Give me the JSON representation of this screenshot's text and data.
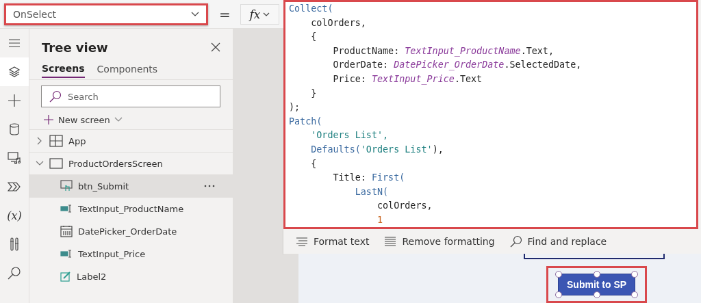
{
  "formula_bar": {
    "property": "OnSelect",
    "highlighted": true,
    "equals": "=",
    "fx": "fx"
  },
  "rail": [
    {
      "kind": "menu",
      "selected": false
    },
    {
      "kind": "layers",
      "selected": true
    },
    {
      "kind": "plus",
      "selected": false
    },
    {
      "kind": "data",
      "selected": false
    },
    {
      "kind": "media",
      "selected": false
    },
    {
      "kind": "automate",
      "selected": false
    },
    {
      "kind": "variables",
      "label": "(x)",
      "selected": false
    },
    {
      "kind": "tools",
      "selected": false
    },
    {
      "kind": "search",
      "selected": false
    }
  ],
  "tree_view": {
    "title": "Tree view",
    "tabs": [
      {
        "label": "Screens",
        "selected": true
      },
      {
        "label": "Components",
        "selected": false
      }
    ],
    "search": {
      "placeholder": "Search"
    },
    "new_screen": "New screen",
    "items": [
      {
        "label": "App",
        "kind": "app",
        "expanded": false,
        "selected": false
      },
      {
        "label": "ProductOrdersScreen",
        "kind": "screen",
        "expanded": true,
        "selected": false,
        "children": [
          {
            "label": "btn_Submit",
            "kind": "button",
            "selected": true
          },
          {
            "label": "TextInput_ProductName",
            "kind": "text-input",
            "selected": false
          },
          {
            "label": "DatePicker_OrderDate",
            "kind": "date-picker",
            "selected": false
          },
          {
            "label": "TextInput_Price",
            "kind": "text-input",
            "selected": false
          },
          {
            "label": "Label2",
            "kind": "label",
            "selected": false
          }
        ]
      }
    ]
  },
  "formula_editor": {
    "highlighted": true,
    "lines": [
      [
        {
          "text": "Collect(",
          "kind": "fn"
        }
      ],
      [
        {
          "text": "    colOrders,",
          "kind": "plain"
        }
      ],
      [
        {
          "text": "    {",
          "kind": "plain"
        }
      ],
      [
        {
          "text": "        ProductName: ",
          "kind": "plain"
        },
        {
          "text": "TextInput_ProductName",
          "kind": "control"
        },
        {
          "text": ".Text,",
          "kind": "plain"
        }
      ],
      [
        {
          "text": "        OrderDate: ",
          "kind": "plain"
        },
        {
          "text": "DatePicker_OrderDate",
          "kind": "control"
        },
        {
          "text": ".SelectedDate,",
          "kind": "plain"
        }
      ],
      [
        {
          "text": "        Price: ",
          "kind": "plain"
        },
        {
          "text": "TextInput_Price",
          "kind": "control"
        },
        {
          "text": ".Text",
          "kind": "plain"
        }
      ],
      [
        {
          "text": "    }",
          "kind": "plain"
        }
      ],
      [
        {
          "text": ");",
          "kind": "plain"
        }
      ],
      [
        {
          "text": "Patch(",
          "kind": "fn"
        }
      ],
      [
        {
          "text": "    'Orders List',",
          "kind": "string"
        }
      ],
      [
        {
          "text": "    Defaults(",
          "kind": "fn"
        },
        {
          "text": "'Orders List'",
          "kind": "string"
        },
        {
          "text": "),",
          "kind": "plain"
        }
      ],
      [
        {
          "text": "    {",
          "kind": "plain"
        }
      ],
      [
        {
          "text": "        Title: ",
          "kind": "plain"
        },
        {
          "text": "First(",
          "kind": "fn"
        }
      ],
      [
        {
          "text": "            LastN(",
          "kind": "fn"
        }
      ],
      [
        {
          "text": "                colOrders,",
          "kind": "plain"
        }
      ],
      [
        {
          "text": "                1",
          "kind": "number"
        }
      ]
    ]
  },
  "editor_toolbar": [
    {
      "label": "Format text",
      "kind": "format"
    },
    {
      "label": "Remove formatting",
      "kind": "remove"
    },
    {
      "label": "Find and replace",
      "kind": "find"
    }
  ],
  "canvas_button": {
    "label": "Submit to SP",
    "selected": true,
    "highlighted": true
  }
}
